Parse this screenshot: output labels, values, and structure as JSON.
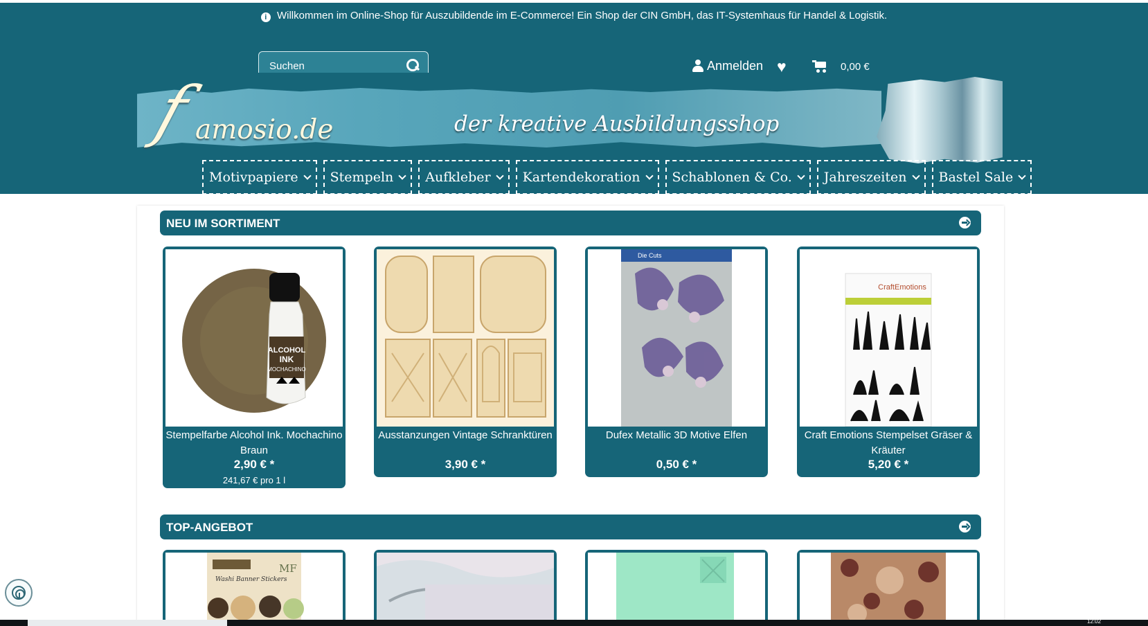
{
  "header": {
    "notice": "Willkommen im Online-Shop für Auszubildende im E-Commerce! Ein Shop der CIN GmbH, das IT-Systemhaus für Handel & Logistik.",
    "search_placeholder": "Suchen",
    "login_label": "Anmelden",
    "cart_total": "0,00 €",
    "logo_f": "f",
    "logo_text": "amosio.de",
    "slogan": "der kreative Ausbildungsshop",
    "colors": {
      "header": "#166578",
      "banner_paper": "#58a6bb",
      "card": "#166578"
    }
  },
  "nav": [
    {
      "label": "Motivpapiere"
    },
    {
      "label": "Stempeln"
    },
    {
      "label": "Aufkleber"
    },
    {
      "label": "Kartendekoration"
    },
    {
      "label": "Schablonen & Co."
    },
    {
      "label": "Jahreszeiten"
    },
    {
      "label": "Bastel Sale"
    }
  ],
  "sections": {
    "new": {
      "title": "NEU IM SORTIMENT",
      "products": [
        {
          "name": "Stempelfarbe Alcohol Ink. Mochachino Braun",
          "price": "2,90 € *",
          "unit_price": "241,67 € pro 1 l",
          "image_text": [
            "ALCOHOL",
            "INK",
            "MOCHACHINO"
          ]
        },
        {
          "name": "Ausstanzungen Vintage Schranktüren",
          "price": "3,90 € *",
          "unit_price": ""
        },
        {
          "name": "Dufex Metallic 3D Motive Elfen",
          "price": "0,50 € *",
          "unit_price": "",
          "image_text": [
            "Die Cuts"
          ]
        },
        {
          "name": "Craft Emotions Stempelset Gräser & Kräuter",
          "price": "5,20 € *",
          "unit_price": "",
          "image_text": [
            "CraftEmotions"
          ]
        }
      ]
    },
    "top": {
      "title": "TOP-ANGEBOT",
      "products": [
        {
          "image_text": [
            "Washi Banner Stickers",
            "MF"
          ]
        },
        {
          "image_text": []
        },
        {
          "image_text": []
        },
        {
          "image_text": []
        }
      ]
    }
  },
  "taskbar": {
    "time": "12:02"
  }
}
